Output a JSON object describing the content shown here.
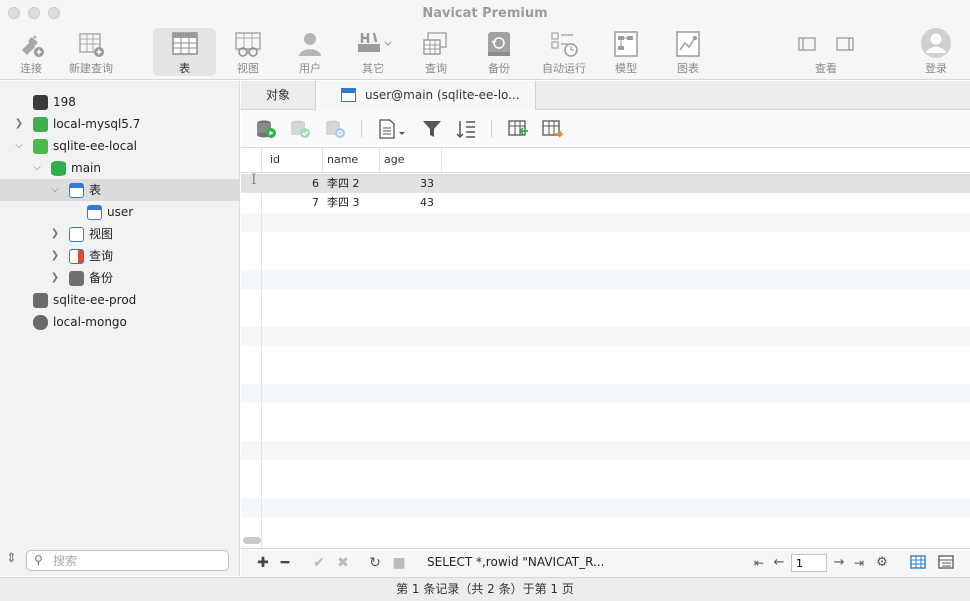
{
  "window": {
    "title": "Navicat Premium"
  },
  "toolbar": {
    "items": [
      {
        "label": "连接"
      },
      {
        "label": "新建查询"
      },
      {
        "label": "表"
      },
      {
        "label": "视图"
      },
      {
        "label": "用户"
      },
      {
        "label": "其它"
      },
      {
        "label": "查询"
      },
      {
        "label": "备份"
      },
      {
        "label": "自动运行"
      },
      {
        "label": "模型"
      },
      {
        "label": "图表"
      },
      {
        "label": "查看"
      },
      {
        "label": "登录"
      }
    ],
    "active": "表"
  },
  "sidebar": {
    "items": [
      {
        "label": "198",
        "icon": "mysql-connection-icon"
      },
      {
        "label": "local-mysql5.7",
        "icon": "mysql-connection-icon"
      },
      {
        "label": "sqlite-ee-local",
        "icon": "sqlite-connection-icon"
      },
      {
        "label": "main",
        "icon": "database-icon"
      },
      {
        "label": "表",
        "icon": "table-folder-icon"
      },
      {
        "label": "user",
        "icon": "table-icon"
      },
      {
        "label": "视图",
        "icon": "view-folder-icon"
      },
      {
        "label": "查询",
        "icon": "query-folder-icon"
      },
      {
        "label": "备份",
        "icon": "backup-folder-icon"
      },
      {
        "label": "sqlite-ee-prod",
        "icon": "sqlite-connection-icon"
      },
      {
        "label": "local-mongo",
        "icon": "mongo-connection-icon"
      }
    ],
    "selected": "表",
    "search_placeholder": "搜索"
  },
  "tabs": [
    {
      "label": "对象"
    },
    {
      "label": "user@main (sqlite-ee-lo..."
    }
  ],
  "grid": {
    "columns": [
      "id",
      "name",
      "age"
    ],
    "rows": [
      {
        "id": "6",
        "name": "李四 2",
        "age": "33"
      },
      {
        "id": "7",
        "name": "李四 3",
        "age": "43"
      }
    ]
  },
  "statusbar": {
    "sql": "SELECT *,rowid \"NAVICAT_R...",
    "page": "1"
  },
  "footer": {
    "text": "第 1 条记录（共 2 条）于第 1 页"
  },
  "colors": {
    "accent": "#2f7bd6",
    "mysql": "#3cb14a",
    "sqlite": "#4bb84a",
    "selected_row": "#e1e1e1"
  }
}
